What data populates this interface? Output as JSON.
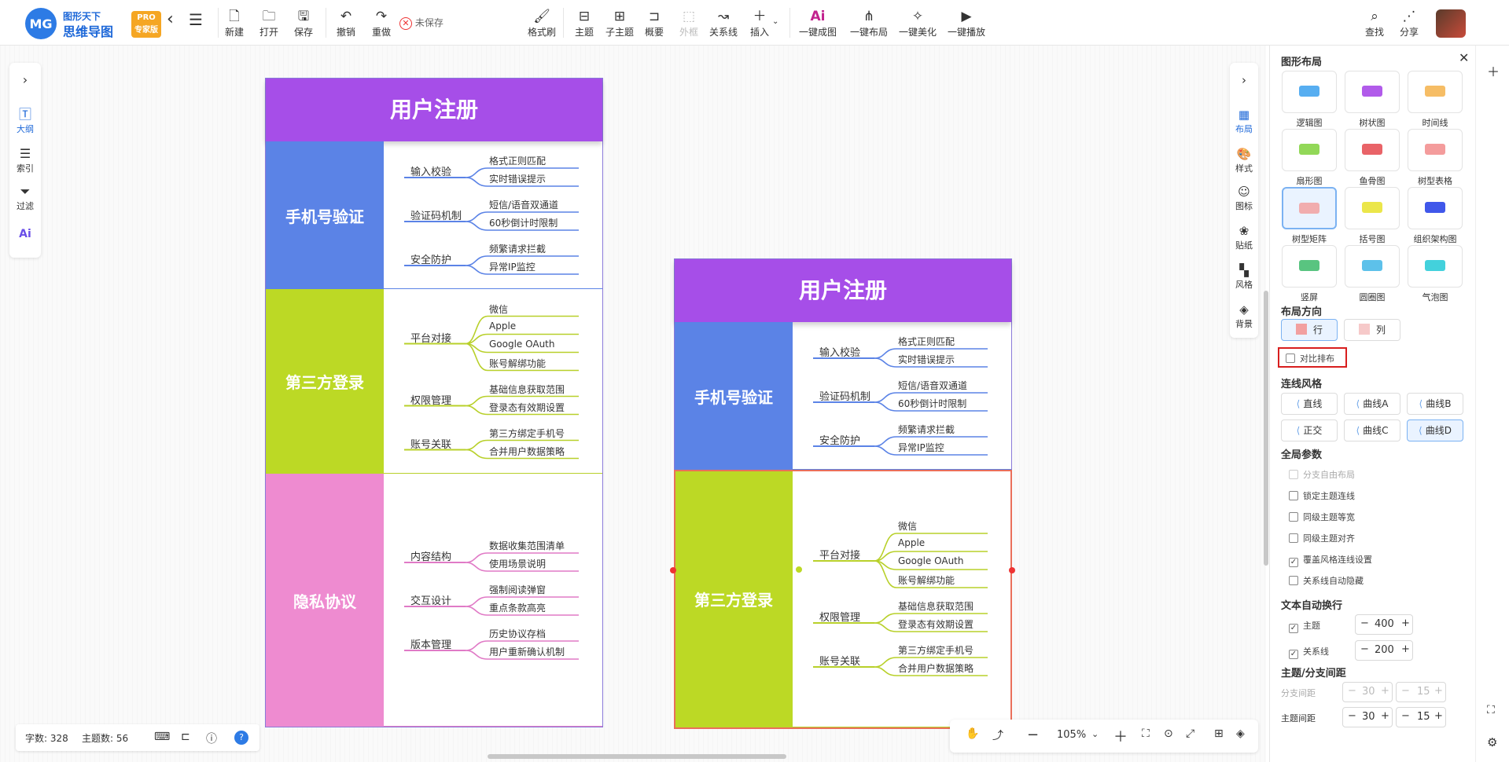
{
  "brand": {
    "logo_letter": "MG",
    "line1": "图形天下",
    "line2": "思维导图",
    "pro_line1": "PRO",
    "pro_line2": "专家版"
  },
  "toolbar": {
    "new": "新建",
    "open": "打开",
    "save": "保存",
    "undo": "撤销",
    "redo": "重做",
    "unsaved": "未保存",
    "format_brush": "格式刷",
    "topic": "主题",
    "subtopic": "子主题",
    "summary": "概要",
    "frame": "外框",
    "relation": "关系线",
    "insert": "插入",
    "ai_map": "一键成图",
    "auto_layout": "一键布局",
    "beautify": "一键美化",
    "play": "一键播放",
    "find": "查找",
    "share": "分享"
  },
  "left_sidebar": {
    "outline": "大纲",
    "index": "索引",
    "filter": "过滤",
    "ai": "Ai"
  },
  "right_sidebar": {
    "layout": "布局",
    "style": "样式",
    "icon": "图标",
    "sticker": "贴纸",
    "theme": "风格",
    "background": "背景"
  },
  "mindmap": {
    "title": "用户注册",
    "sections": [
      {
        "title": "手机号验证",
        "color": "#5b83e6",
        "line_color": "#5b83e6",
        "branches": [
          {
            "label": "输入校验",
            "leaves": [
              "格式正则匹配",
              "实时错误提示"
            ]
          },
          {
            "label": "验证码机制",
            "leaves": [
              "短信/语音双通道",
              "60秒倒计时限制"
            ]
          },
          {
            "label": "安全防护",
            "leaves": [
              "频繁请求拦截",
              "异常IP监控"
            ]
          }
        ]
      },
      {
        "title": "第三方登录",
        "color": "#bcd925",
        "line_color": "#b8d02a",
        "branches": [
          {
            "label": "平台对接",
            "leaves": [
              "微信",
              "Apple",
              "Google OAuth",
              "账号解绑功能"
            ]
          },
          {
            "label": "权限管理",
            "leaves": [
              "基础信息获取范围",
              "登录态有效期设置"
            ]
          },
          {
            "label": "账号关联",
            "leaves": [
              "第三方绑定手机号",
              "合并用户数据策略"
            ]
          }
        ]
      },
      {
        "title": "隐私协议",
        "color": "#ee8bd0",
        "line_color": "#e07ac6",
        "branches": [
          {
            "label": "内容结构",
            "leaves": [
              "数据收集范围清单",
              "使用场景说明"
            ]
          },
          {
            "label": "交互设计",
            "leaves": [
              "强制阅读弹窗",
              "重点条款高亮"
            ]
          },
          {
            "label": "版本管理",
            "leaves": [
              "历史协议存档",
              "用户重新确认机制"
            ]
          }
        ]
      }
    ]
  },
  "status": {
    "words": "字数: 328",
    "topics": "主题数: 56",
    "help": "?"
  },
  "zoom": {
    "level": "105%"
  },
  "panel": {
    "title": "图形布局",
    "layouts": [
      "逻辑图",
      "树状图",
      "时间线",
      "扇形图",
      "鱼骨图",
      "树型表格",
      "树型矩阵",
      "括号图",
      "组织架构图",
      "竖屏",
      "圆圈图",
      "气泡图"
    ],
    "selected_layout": "树型矩阵",
    "direction_title": "布局方向",
    "direction_row": "行",
    "direction_col": "列",
    "contrast_label": "对比排布",
    "line_style_title": "连线风格",
    "line_styles": [
      "直线",
      "曲线A",
      "曲线B",
      "正交",
      "曲线C",
      "曲线D"
    ],
    "selected_line_style": "曲线D",
    "global_title": "全局参数",
    "global_options": [
      {
        "label": "分支自由布局",
        "checked": false,
        "disabled": true
      },
      {
        "label": "锁定主题连线",
        "checked": false,
        "disabled": false
      },
      {
        "label": "同级主题等宽",
        "checked": false,
        "disabled": false
      },
      {
        "label": "同级主题对齐",
        "checked": false,
        "disabled": false
      },
      {
        "label": "覆盖风格连线设置",
        "checked": true,
        "disabled": false
      },
      {
        "label": "关系线自动隐藏",
        "checked": false,
        "disabled": false
      }
    ],
    "wrap_title": "文本自动换行",
    "wrap_topic_label": "主题",
    "wrap_topic_value": "400",
    "wrap_relation_label": "关系线",
    "wrap_relation_value": "200",
    "spacing_title": "主题/分支间距",
    "branch_spacing_label": "分支间距",
    "branch_spacing_a": "30",
    "branch_spacing_b": "15",
    "topic_spacing_label": "主题间距",
    "topic_spacing_a": "30",
    "topic_spacing_b": "15"
  }
}
